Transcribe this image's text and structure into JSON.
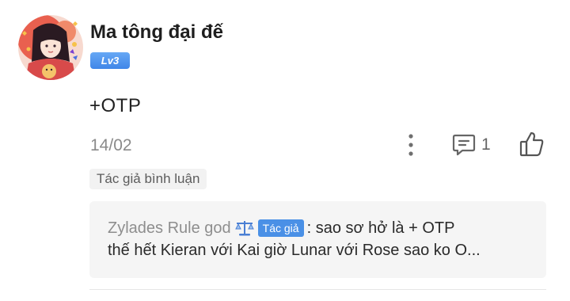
{
  "comment": {
    "username": "Ma tông đại đế",
    "level": "Lv3",
    "body": "+OTP",
    "date": "14/02",
    "reply_count": "1",
    "author_comment_label": "Tác giả bình luận"
  },
  "reply_preview": {
    "author": "Zylades Rule god",
    "author_tag": "Tác giả",
    "text_line1": ": sao sơ hở là + OTP",
    "text_line2": "thế hết Kieran với Kai giờ Lunar với Rose sao ko O..."
  },
  "icons": {
    "more": "more-vertical-icon",
    "reply": "comment-icon",
    "like": "thumbs-up-icon",
    "author_emoji": "balance-scale-icon"
  },
  "colors": {
    "level_badge": "#4a90e6",
    "author_tag": "#4a90e6",
    "reply_background": "#f5f5f5",
    "muted_text": "#8a8a8a"
  }
}
